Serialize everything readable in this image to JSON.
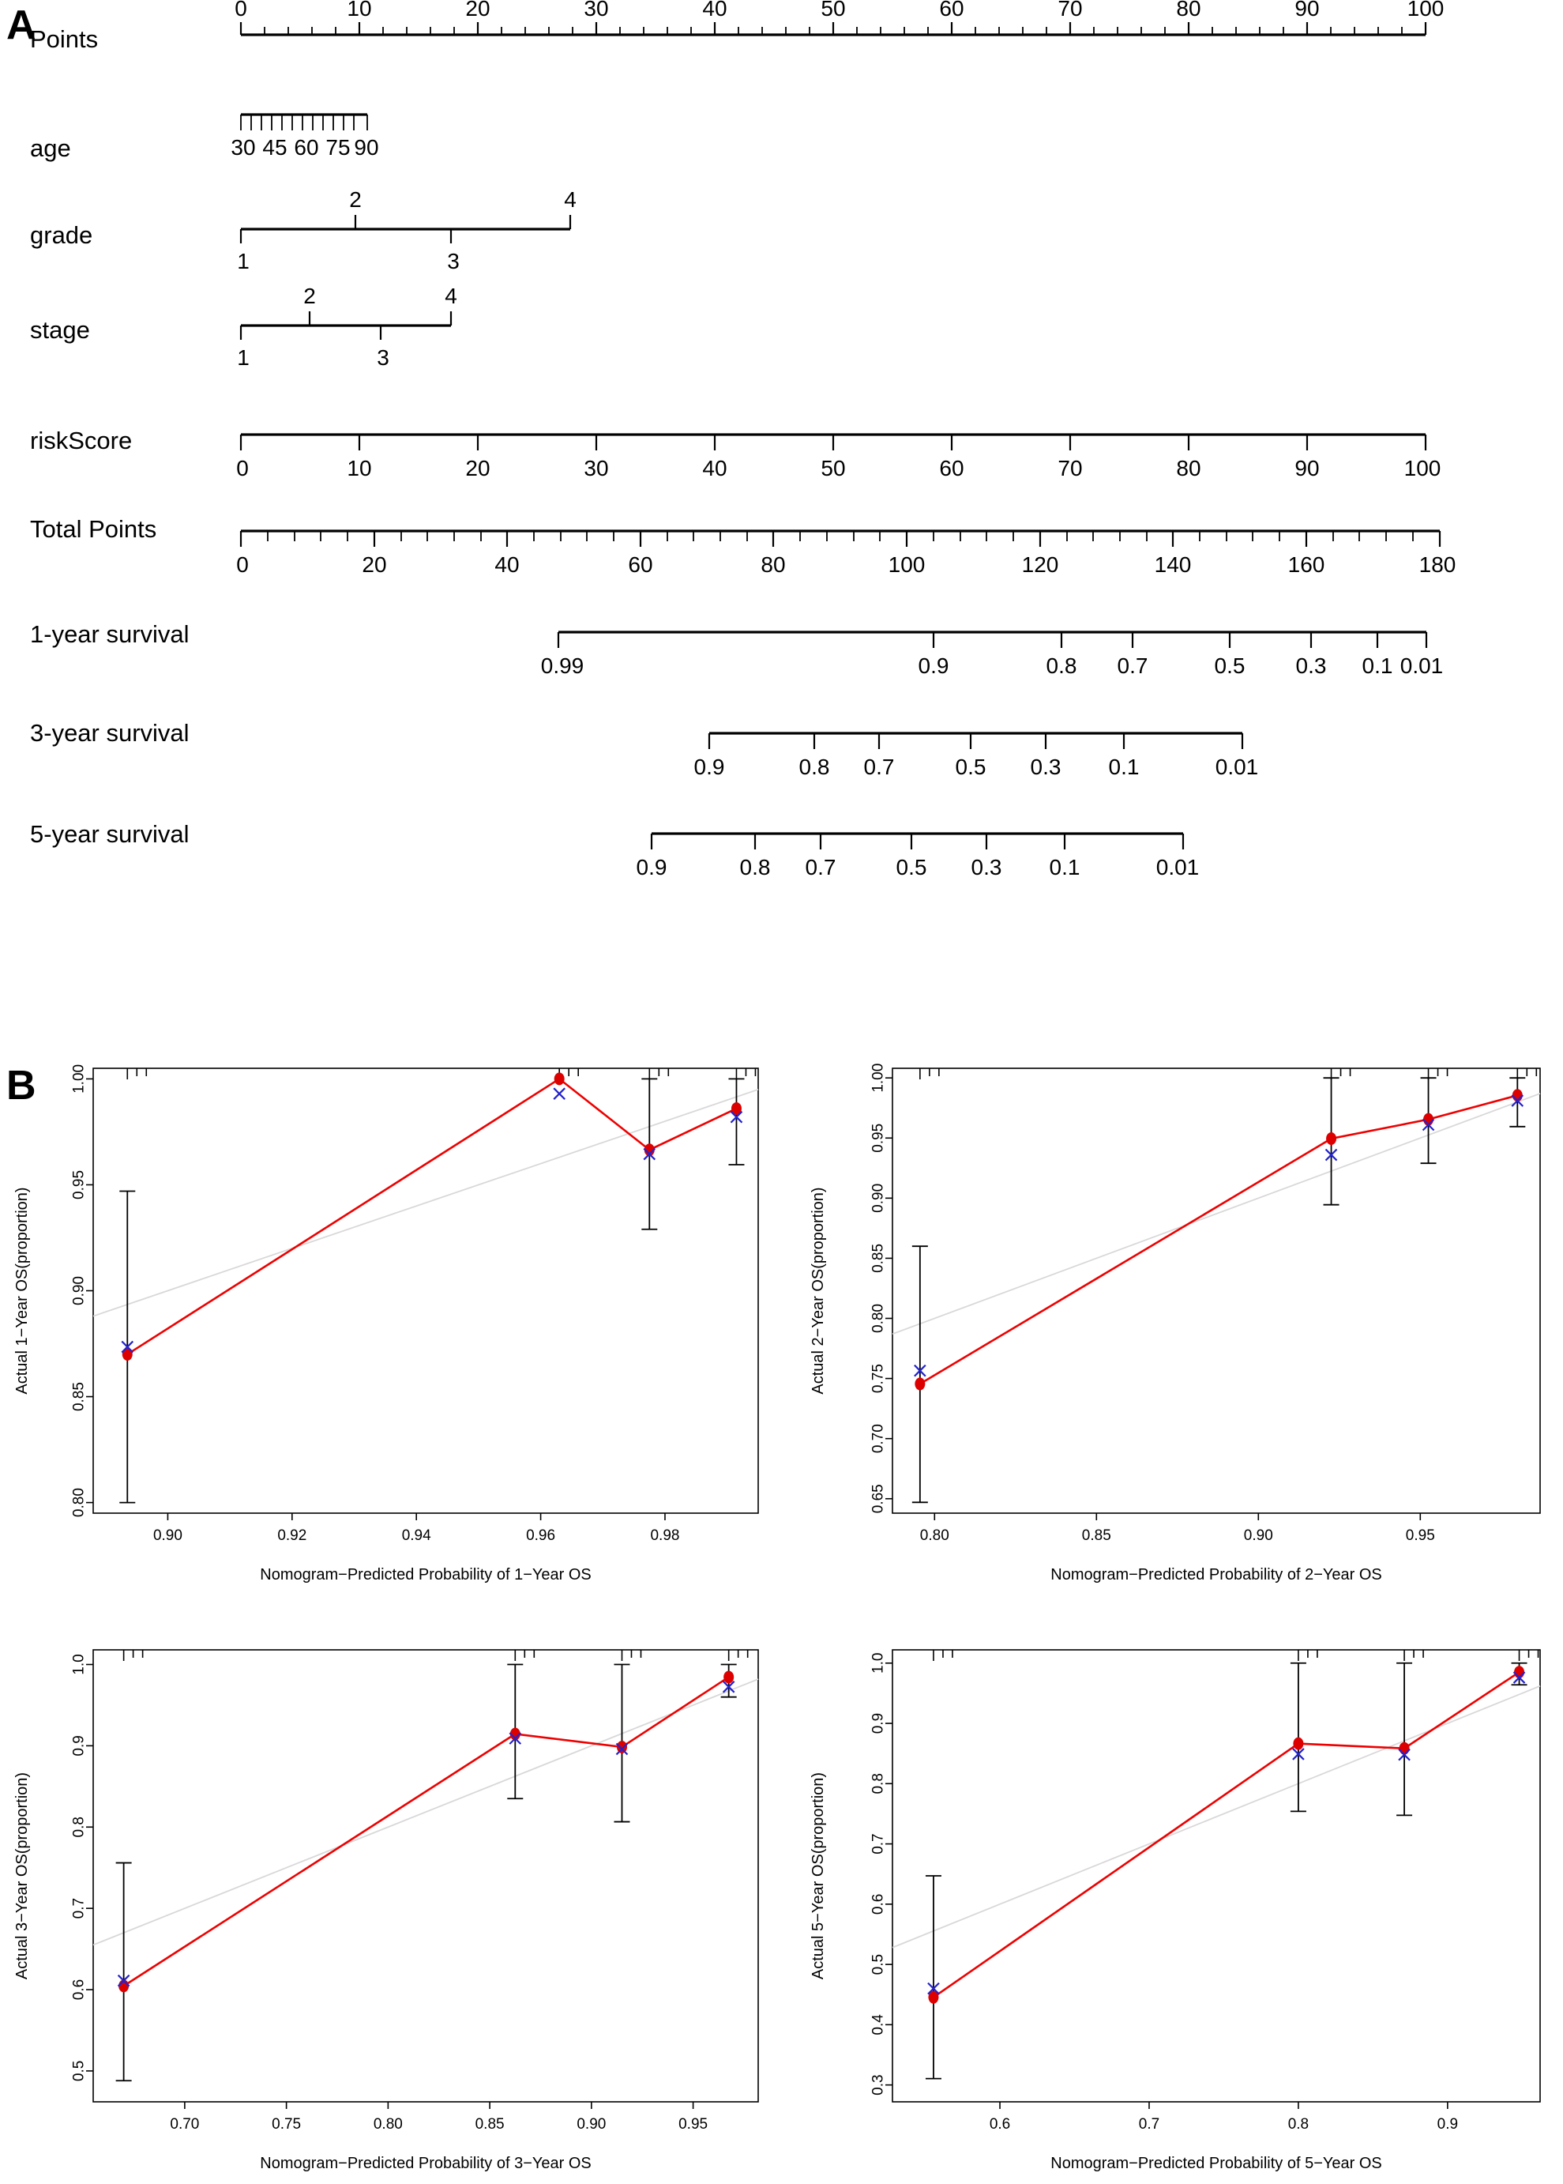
{
  "figure": {
    "panel_a_letter": "A",
    "panel_b_letter": "B"
  },
  "nomogram": {
    "rows": [
      {
        "label": "Points"
      },
      {
        "label": "age"
      },
      {
        "label": "grade"
      },
      {
        "label": "stage"
      },
      {
        "label": "riskScore"
      },
      {
        "label": "Total Points"
      },
      {
        "label": "1-year survival"
      },
      {
        "label": "3-year survival"
      },
      {
        "label": "5-year survival"
      }
    ],
    "points_axis": {
      "ticks": [
        "0",
        "10",
        "20",
        "30",
        "40",
        "50",
        "60",
        "70",
        "80",
        "90",
        "100"
      ],
      "label_side": "above"
    },
    "age_axis": {
      "ticks": [
        "30",
        "45",
        "60",
        "75",
        "90"
      ],
      "label_side": "below"
    },
    "grade_axis": {
      "ticks_above": [
        "2",
        "4"
      ],
      "ticks_below": [
        "1",
        "3"
      ]
    },
    "stage_axis": {
      "ticks_above": [
        "2",
        "4"
      ],
      "ticks_below": [
        "1",
        "3"
      ]
    },
    "riskscore_axis": {
      "ticks": [
        "0",
        "10",
        "20",
        "30",
        "40",
        "50",
        "60",
        "70",
        "80",
        "90",
        "100"
      ],
      "label_side": "below"
    },
    "total_points_axis": {
      "ticks": [
        "0",
        "20",
        "40",
        "60",
        "80",
        "100",
        "120",
        "140",
        "160",
        "180"
      ],
      "label_side": "below"
    },
    "survival_1y_axis": {
      "ticks": [
        "0.99",
        "0.9",
        "0.8",
        "0.7",
        "0.5",
        "0.3",
        "0.1",
        "0.01"
      ],
      "label_side": "below"
    },
    "survival_3y_axis": {
      "ticks": [
        "0.9",
        "0.8",
        "0.7",
        "0.5",
        "0.3",
        "0.1",
        "0.01"
      ],
      "label_side": "below"
    },
    "survival_5y_axis": {
      "ticks": [
        "0.9",
        "0.8",
        "0.7",
        "0.5",
        "0.3",
        "0.1",
        "0.01"
      ],
      "label_side": "below"
    }
  },
  "chart_data": [
    {
      "id": "calibration-1y",
      "type": "line",
      "title": "",
      "xlabel": "Nomogram−Predicted Probability of 1−Year OS",
      "ylabel": "Actual 1−Year OS(proportion)",
      "xlim": [
        0.888,
        0.995
      ],
      "ylim": [
        0.795,
        1.005
      ],
      "xticks": [
        0.9,
        0.92,
        0.94,
        0.96,
        0.98
      ],
      "xticklabels": [
        "0.90",
        "0.92",
        "0.94",
        "0.96",
        "0.98"
      ],
      "yticks": [
        0.8,
        0.85,
        0.9,
        0.95,
        1.0
      ],
      "yticklabels": [
        "0.80",
        "0.85",
        "0.90",
        "0.95",
        "1.00"
      ],
      "grid": false,
      "legend": "none",
      "identity_line": true,
      "series": [
        {
          "name": "Observed (KM, red dots)",
          "x": [
            0.8935,
            0.963,
            0.9775,
            0.9915
          ],
          "y": [
            0.87,
            1.0,
            0.9665,
            0.986
          ],
          "err_low": [
            0.8,
            1.0,
            0.929,
            0.9595
          ],
          "err_high": [
            0.947,
            1.0,
            1.0,
            1.0
          ]
        },
        {
          "name": "Bias-corrected (blue x)",
          "x": [
            0.8935,
            0.963,
            0.9775,
            0.9915
          ],
          "y": [
            0.8735,
            0.993,
            0.9645,
            0.982
          ]
        }
      ]
    },
    {
      "id": "calibration-2y",
      "type": "line",
      "title": "",
      "xlabel": "Nomogram−Predicted Probability of 2−Year OS",
      "ylabel": "Actual 2−Year OS(proportion)",
      "xlim": [
        0.787,
        0.987
      ],
      "ylim": [
        0.638,
        1.008
      ],
      "xticks": [
        0.8,
        0.85,
        0.9,
        0.95
      ],
      "xticklabels": [
        "0.80",
        "0.85",
        "0.90",
        "0.95"
      ],
      "yticks": [
        0.65,
        0.7,
        0.75,
        0.8,
        0.85,
        0.9,
        0.95,
        1.0
      ],
      "yticklabels": [
        "0.65",
        "0.70",
        "0.75",
        "0.80",
        "0.85",
        "0.90",
        "0.95",
        "1.00"
      ],
      "grid": false,
      "legend": "none",
      "identity_line": true,
      "series": [
        {
          "name": "Observed (KM, red dots)",
          "x": [
            0.7955,
            0.9225,
            0.9525,
            0.98
          ],
          "y": [
            0.7455,
            0.9495,
            0.9655,
            0.9855
          ],
          "err_low": [
            0.647,
            0.8945,
            0.929,
            0.9595
          ],
          "err_high": [
            0.86,
            1.0,
            1.0,
            1.0
          ]
        },
        {
          "name": "Bias-corrected (blue x)",
          "x": [
            0.7955,
            0.9225,
            0.9525,
            0.98
          ],
          "y": [
            0.7565,
            0.936,
            0.961,
            0.981
          ]
        }
      ]
    },
    {
      "id": "calibration-3y",
      "type": "line",
      "title": "",
      "xlabel": "Nomogram−Predicted Probability of 3−Year OS",
      "ylabel": "Actual 3−Year OS(proportion)",
      "xlim": [
        0.655,
        0.982
      ],
      "ylim": [
        0.462,
        1.018
      ],
      "xticks": [
        0.7,
        0.75,
        0.8,
        0.85,
        0.9,
        0.95
      ],
      "xticklabels": [
        "0.70",
        "0.75",
        "0.80",
        "0.85",
        "0.90",
        "0.95"
      ],
      "yticks": [
        0.5,
        0.6,
        0.7,
        0.8,
        0.9,
        1.0
      ],
      "yticklabels": [
        "0.5",
        "0.6",
        "0.7",
        "0.8",
        "0.9",
        "1.0"
      ],
      "grid": false,
      "legend": "none",
      "identity_line": true,
      "series": [
        {
          "name": "Observed (KM, red dots)",
          "x": [
            0.67,
            0.8625,
            0.915,
            0.9675
          ],
          "y": [
            0.6045,
            0.9145,
            0.8985,
            0.9845
          ],
          "err_low": [
            0.488,
            0.835,
            0.8065,
            0.96
          ],
          "err_high": [
            0.756,
            1.0,
            1.0,
            1.0
          ]
        },
        {
          "name": "Bias-corrected (blue x)",
          "x": [
            0.67,
            0.8625,
            0.915,
            0.9675
          ],
          "y": [
            0.611,
            0.909,
            0.896,
            0.9725
          ]
        }
      ]
    },
    {
      "id": "calibration-5y",
      "type": "line",
      "title": "",
      "xlabel": "Nomogram−Predicted Probability of 5−Year OS",
      "ylabel": "Actual 5−Year OS(proportion)",
      "xlim": [
        0.528,
        0.962
      ],
      "ylim": [
        0.272,
        1.022
      ],
      "xticks": [
        0.6,
        0.7,
        0.8,
        0.9
      ],
      "xticklabels": [
        "0.6",
        "0.7",
        "0.8",
        "0.9"
      ],
      "yticks": [
        0.3,
        0.4,
        0.5,
        0.6,
        0.7,
        0.8,
        0.9,
        1.0
      ],
      "yticklabels": [
        "0.3",
        "0.4",
        "0.5",
        "0.6",
        "0.7",
        "0.8",
        "0.9",
        "1.0"
      ],
      "grid": false,
      "legend": "none",
      "identity_line": true,
      "series": [
        {
          "name": "Observed (KM, red dots)",
          "x": [
            0.5555,
            0.8,
            0.871,
            0.948
          ],
          "y": [
            0.4455,
            0.8665,
            0.8585,
            0.985
          ],
          "err_low": [
            0.3105,
            0.754,
            0.7475,
            0.964
          ],
          "err_high": [
            0.647,
            1.0,
            1.0,
            1.0
          ]
        },
        {
          "name": "Bias-corrected (blue x)",
          "x": [
            0.5555,
            0.8,
            0.871,
            0.948
          ],
          "y": [
            0.46,
            0.849,
            0.848,
            0.976
          ]
        }
      ]
    }
  ]
}
